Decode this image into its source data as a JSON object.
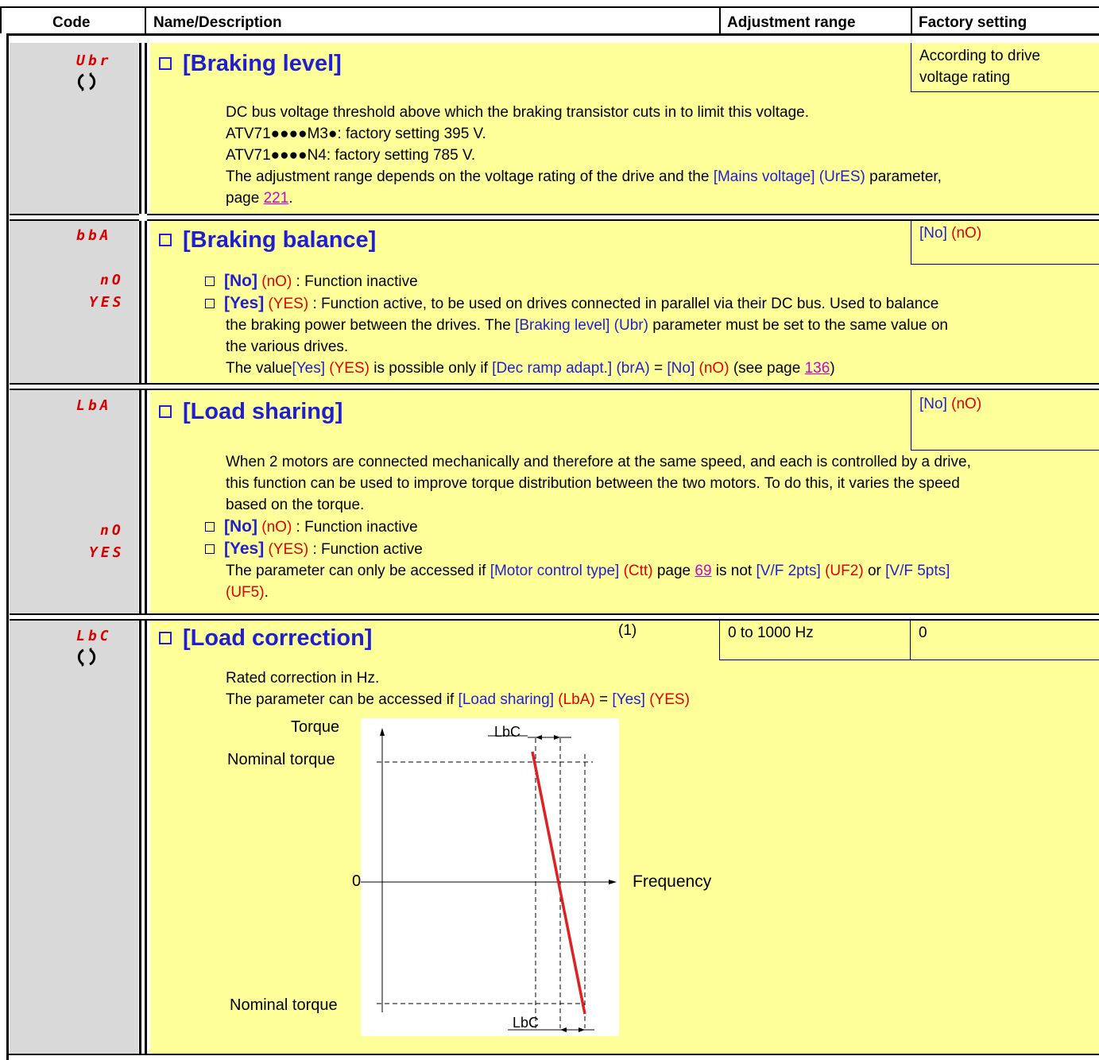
{
  "header": {
    "code": "Code",
    "name": "Name/Description",
    "range": "Adjustment range",
    "factory": "Factory setting"
  },
  "rows": [
    {
      "code": "Ubr",
      "has_icon": true,
      "title": "[Braking level]",
      "factory": "According to drive voltage rating",
      "lines": [
        "DC bus voltage threshold above which the braking transistor cuts in to limit this voltage.",
        "ATV71●●●●M3●: factory setting 395 V.",
        "ATV71●●●●N4: factory setting 785 V.",
        "The adjustment range depends on the voltage rating of the drive and the",
        "[Mains voltage]",
        "(UrES)",
        "parameter,",
        "page",
        "221",
        "."
      ]
    },
    {
      "code": "bbA",
      "title": "[Braking balance]",
      "factory_a": "[No]",
      "factory_b": "(nO)",
      "opt_codes": [
        "nO",
        "YES"
      ],
      "lines": [
        "[No]",
        "(nO)",
        ": Function inactive",
        "[Yes]",
        "(YES)",
        ": Function active, to be used on drives connected in parallel via their DC bus. Used to balance",
        "the braking power between the drives. The ",
        "[Braking level]",
        "(Ubr)",
        "parameter must be set to the same value on",
        "the various drives.",
        "The value",
        "[Yes]",
        "(YES)",
        "is possible only if",
        "[Dec ramp adapt.]",
        "(brA)",
        "=",
        "[No]",
        "(nO)",
        "(see page",
        "136",
        ")"
      ]
    },
    {
      "code": "LbA",
      "title": "[Load sharing]",
      "factory_a": "[No]",
      "factory_b": "(nO)",
      "opt_codes": [
        "nO",
        "YES"
      ],
      "lines": [
        "When 2 motors are connected mechanically and therefore at the same speed, and each is controlled by a drive,",
        "this function can be used to improve torque distribution between the two motors. To do this, it varies the speed",
        "based on the torque.",
        "[No]",
        "(nO)",
        ": Function inactive",
        "[Yes]",
        "(YES)",
        ": Function active",
        "The parameter can only be accessed if",
        "[Motor control type]",
        "(Ctt)",
        "page",
        "69",
        "is not",
        "[V/F 2pts]",
        "(UF2)",
        "or",
        "[V/F 5pts]",
        "(UF5)",
        "."
      ]
    },
    {
      "code": "LbC",
      "has_icon": true,
      "title": "[Load correction]",
      "note": "(1)",
      "range": "0 to 1000 Hz",
      "factory": "0",
      "lines": [
        "Rated correction in Hz.",
        "The parameter can be accessed if",
        "[Load sharing]",
        "(LbA)",
        "=",
        "[Yes]",
        "(YES)"
      ],
      "diagram": {
        "torque": "Torque",
        "nominal_top": "Nominal torque",
        "nominal_bottom": "Nominal torque",
        "zero": "0",
        "frequency": "Frequency",
        "lbc_top": "LbC",
        "lbc_bottom": "LbC"
      }
    }
  ],
  "colors": {
    "blue": "#1f1fd0",
    "red": "#e00000",
    "link": "#d000d0",
    "yellow": "#ffff99",
    "grey": "#d9d9d9"
  }
}
